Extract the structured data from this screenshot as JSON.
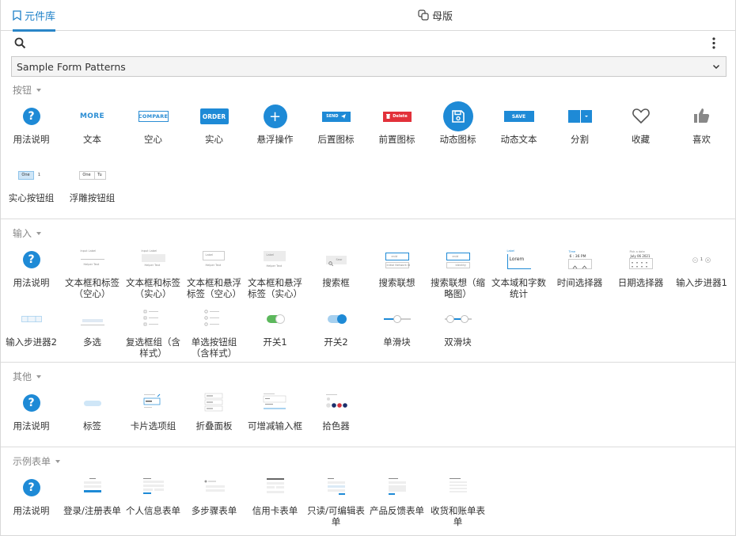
{
  "tabs": {
    "library": "元件库",
    "master": "母版"
  },
  "library_select": {
    "value": "Sample Form Patterns"
  },
  "sections": [
    {
      "title": "按钮",
      "items": [
        "用法说明",
        "文本",
        "空心",
        "实心",
        "悬浮操作",
        "后置图标",
        "前置图标",
        "动态图标",
        "动态文本",
        "分割",
        "收藏",
        "喜欢",
        "实心按钮组",
        "浮雕按钮组"
      ]
    },
    {
      "title": "输入",
      "items": [
        "用法说明",
        "文本框和标签（空心）",
        "文本框和标签（实心）",
        "文本框和悬浮标签（空心）",
        "文本框和悬浮标签（实心）",
        "搜索框",
        "搜索联想",
        "搜索联想（缩略图）",
        "文本域和字数统计",
        "时间选择器",
        "日期选择器",
        "输入步进器1",
        "输入步进器2",
        "多选",
        "复选框组（含样式）",
        "单选按钮组（含样式）",
        "开关1",
        "开关2",
        "单滑块",
        "双滑块"
      ]
    },
    {
      "title": "其他",
      "items": [
        "用法说明",
        "标签",
        "卡片选项组",
        "折叠面板",
        "可增减输入框",
        "拾色器"
      ]
    },
    {
      "title": "示例表单",
      "items": [
        "用法说明",
        "登录/注册表单",
        "个人信息表单",
        "多步骤表单",
        "信用卡表单",
        "只读/可编辑表单",
        "产品反馈表单",
        "收货和账单表单"
      ]
    }
  ],
  "thumb_text": {
    "more": "MORE",
    "compare": "COMPARE",
    "order": "ORDER",
    "plus": "+",
    "send": "SEND",
    "delete": "Delete",
    "save": "SAVE",
    "seg_one": "One",
    "seg_two": "1",
    "seg2_one": "One",
    "seg2_two": "Tu",
    "input_label": "Input Label",
    "helper_text": "Helper Text",
    "label": "Label",
    "search": "Sear",
    "assoc_query": "enid",
    "assoc_result": "Initial Network Id",
    "assoc_query2": "enid",
    "assoc_result2": "Identity",
    "lorem": "Lorem",
    "time_label": "Time",
    "time_value": "6 : 36 PM",
    "date_label": "Pick a date",
    "date_value": "July 06 2021",
    "stepper_value": "1",
    "question": "?"
  },
  "colors": {
    "accent": "#1e8ad6",
    "danger": "#e2313a",
    "toggle_green": "#5cb85c"
  }
}
